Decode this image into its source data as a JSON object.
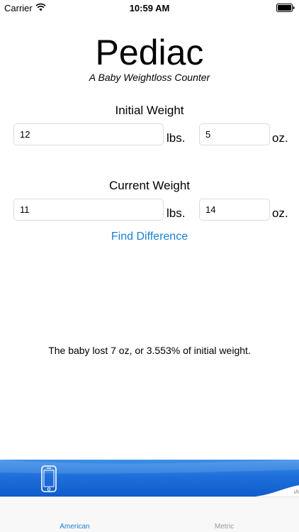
{
  "status_bar": {
    "carrier": "Carrier",
    "time": "10:59 AM"
  },
  "app": {
    "title": "Pediac",
    "subtitle": "A Baby Weightloss Counter"
  },
  "initial": {
    "label": "Initial Weight",
    "lbs_value": "12",
    "oz_value": "5",
    "lbs_unit": "lbs.",
    "oz_unit": "oz."
  },
  "current": {
    "label": "Current Weight",
    "lbs_value": "11",
    "oz_value": "14",
    "lbs_unit": "lbs.",
    "oz_unit": "oz."
  },
  "find_button": "Find Difference",
  "result": "The baby lost 7 oz, or 3.553% of initial weight.",
  "ad": {
    "mark": "iA"
  },
  "tabs": [
    {
      "label": "American"
    },
    {
      "label": "Metric"
    }
  ],
  "colors": {
    "accent": "#1a7fd3",
    "ad_blue": "#1e6fdc",
    "inactive_tab": "#999999"
  }
}
